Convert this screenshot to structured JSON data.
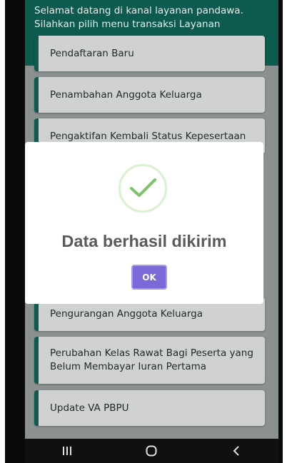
{
  "welcome_text": "Selamat datang di kanal layanan pandawa. Silahkan pilih menu transaksi Layanan",
  "menu": [
    {
      "label": "Pendaftaran Baru"
    },
    {
      "label": "Penambahan Anggota Keluarga"
    },
    {
      "label": "Pengaktifan Kembali Status Kepesertaan"
    },
    {
      "label": "Pengurangan Anggota Keluarga"
    },
    {
      "label": "Perubahan Kelas Rawat Bagi Peserta yang Belum Membayar Iuran Pertama"
    },
    {
      "label": "Update VA PBPU"
    }
  ],
  "dialog": {
    "icon": "check-circle-icon",
    "title": "Data berhasil dikirim",
    "button": "OK"
  },
  "navbar": {
    "recent_icon": "recent-apps-icon",
    "home_icon": "home-icon",
    "back_icon": "back-icon"
  },
  "colors": {
    "accent": "#0e5b4b",
    "button": "#7a6ad8",
    "check": "#7cc36a"
  }
}
